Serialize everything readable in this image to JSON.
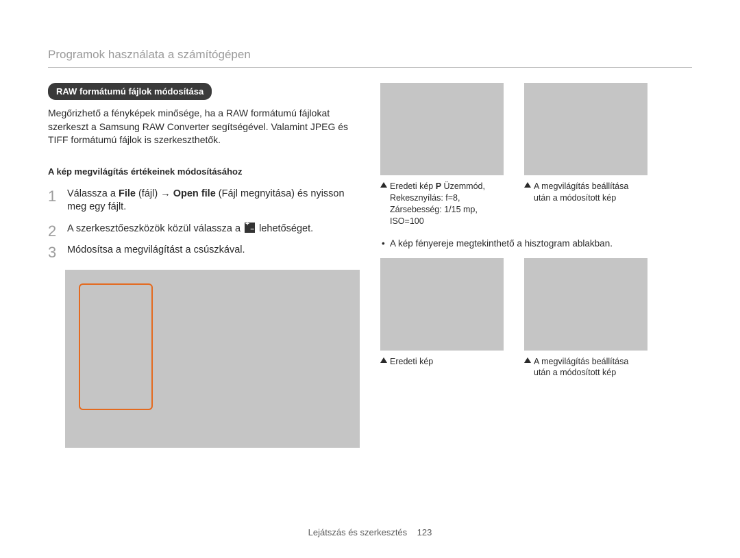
{
  "header": {
    "title": "Programok használata a számítógépen"
  },
  "pill": "RAW formátumú fájlok módosítása",
  "intro": "Megőrizhető a fényképek minősége, ha a RAW formátumú fájlokat szerkeszt a Samsung RAW Converter segítségével. Valamint JPEG és TIFF formátumú fájlok is szerkeszthetők.",
  "subHeading": "A kép megvilágítás értékeinek módosításához",
  "steps": {
    "s1_a": "Válassza a ",
    "s1_file": "File",
    "s1_b": " (fájl) → ",
    "s1_open": "Open ﬁle",
    "s1_c": " (Fájl megnyitása) és nyisson meg egy fájlt.",
    "s2_a": "A szerkesztőeszközök közül válassza a ",
    "s2_b": " lehetőséget.",
    "s3": "Módosítsa a megvilágítást a csúszkával."
  },
  "right": {
    "cap1_line1": "Eredeti kép ",
    "cap1_mode": "P",
    "cap1_line1b": " Üzemmód, Rekesznyílás: f=8, Zársebesség: 1/15 mp, ISO=100",
    "cap2": "A megvilágítás beállítása után a módosított kép",
    "bullet": "A kép fényereje megtekinthető a hisztogram ablakban.",
    "cap3": "Eredeti kép",
    "cap4": "A megvilágítás beállítása után a módosított kép"
  },
  "footer": {
    "section": "Lejátszás és szerkesztés",
    "page": "123"
  }
}
